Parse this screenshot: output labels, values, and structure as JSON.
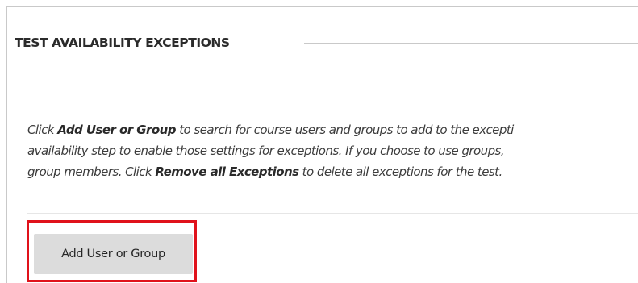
{
  "section": {
    "title": "TEST AVAILABILITY EXCEPTIONS"
  },
  "instructions": {
    "line1": {
      "pre": "Click ",
      "bold": "Add User or Group",
      "post": " to search for course users and groups to add to the excepti"
    },
    "line2": {
      "text": "availability step to enable those settings for exceptions. If you choose to use groups,"
    },
    "line3": {
      "pre": "group members. Click ",
      "bold": "Remove all Exceptions",
      "post": " to delete all exceptions for the test."
    }
  },
  "actions": {
    "add_user_or_group_label": "Add User or Group"
  },
  "colors": {
    "highlight_border": "#e0121b",
    "button_background": "#dcdcdc"
  }
}
